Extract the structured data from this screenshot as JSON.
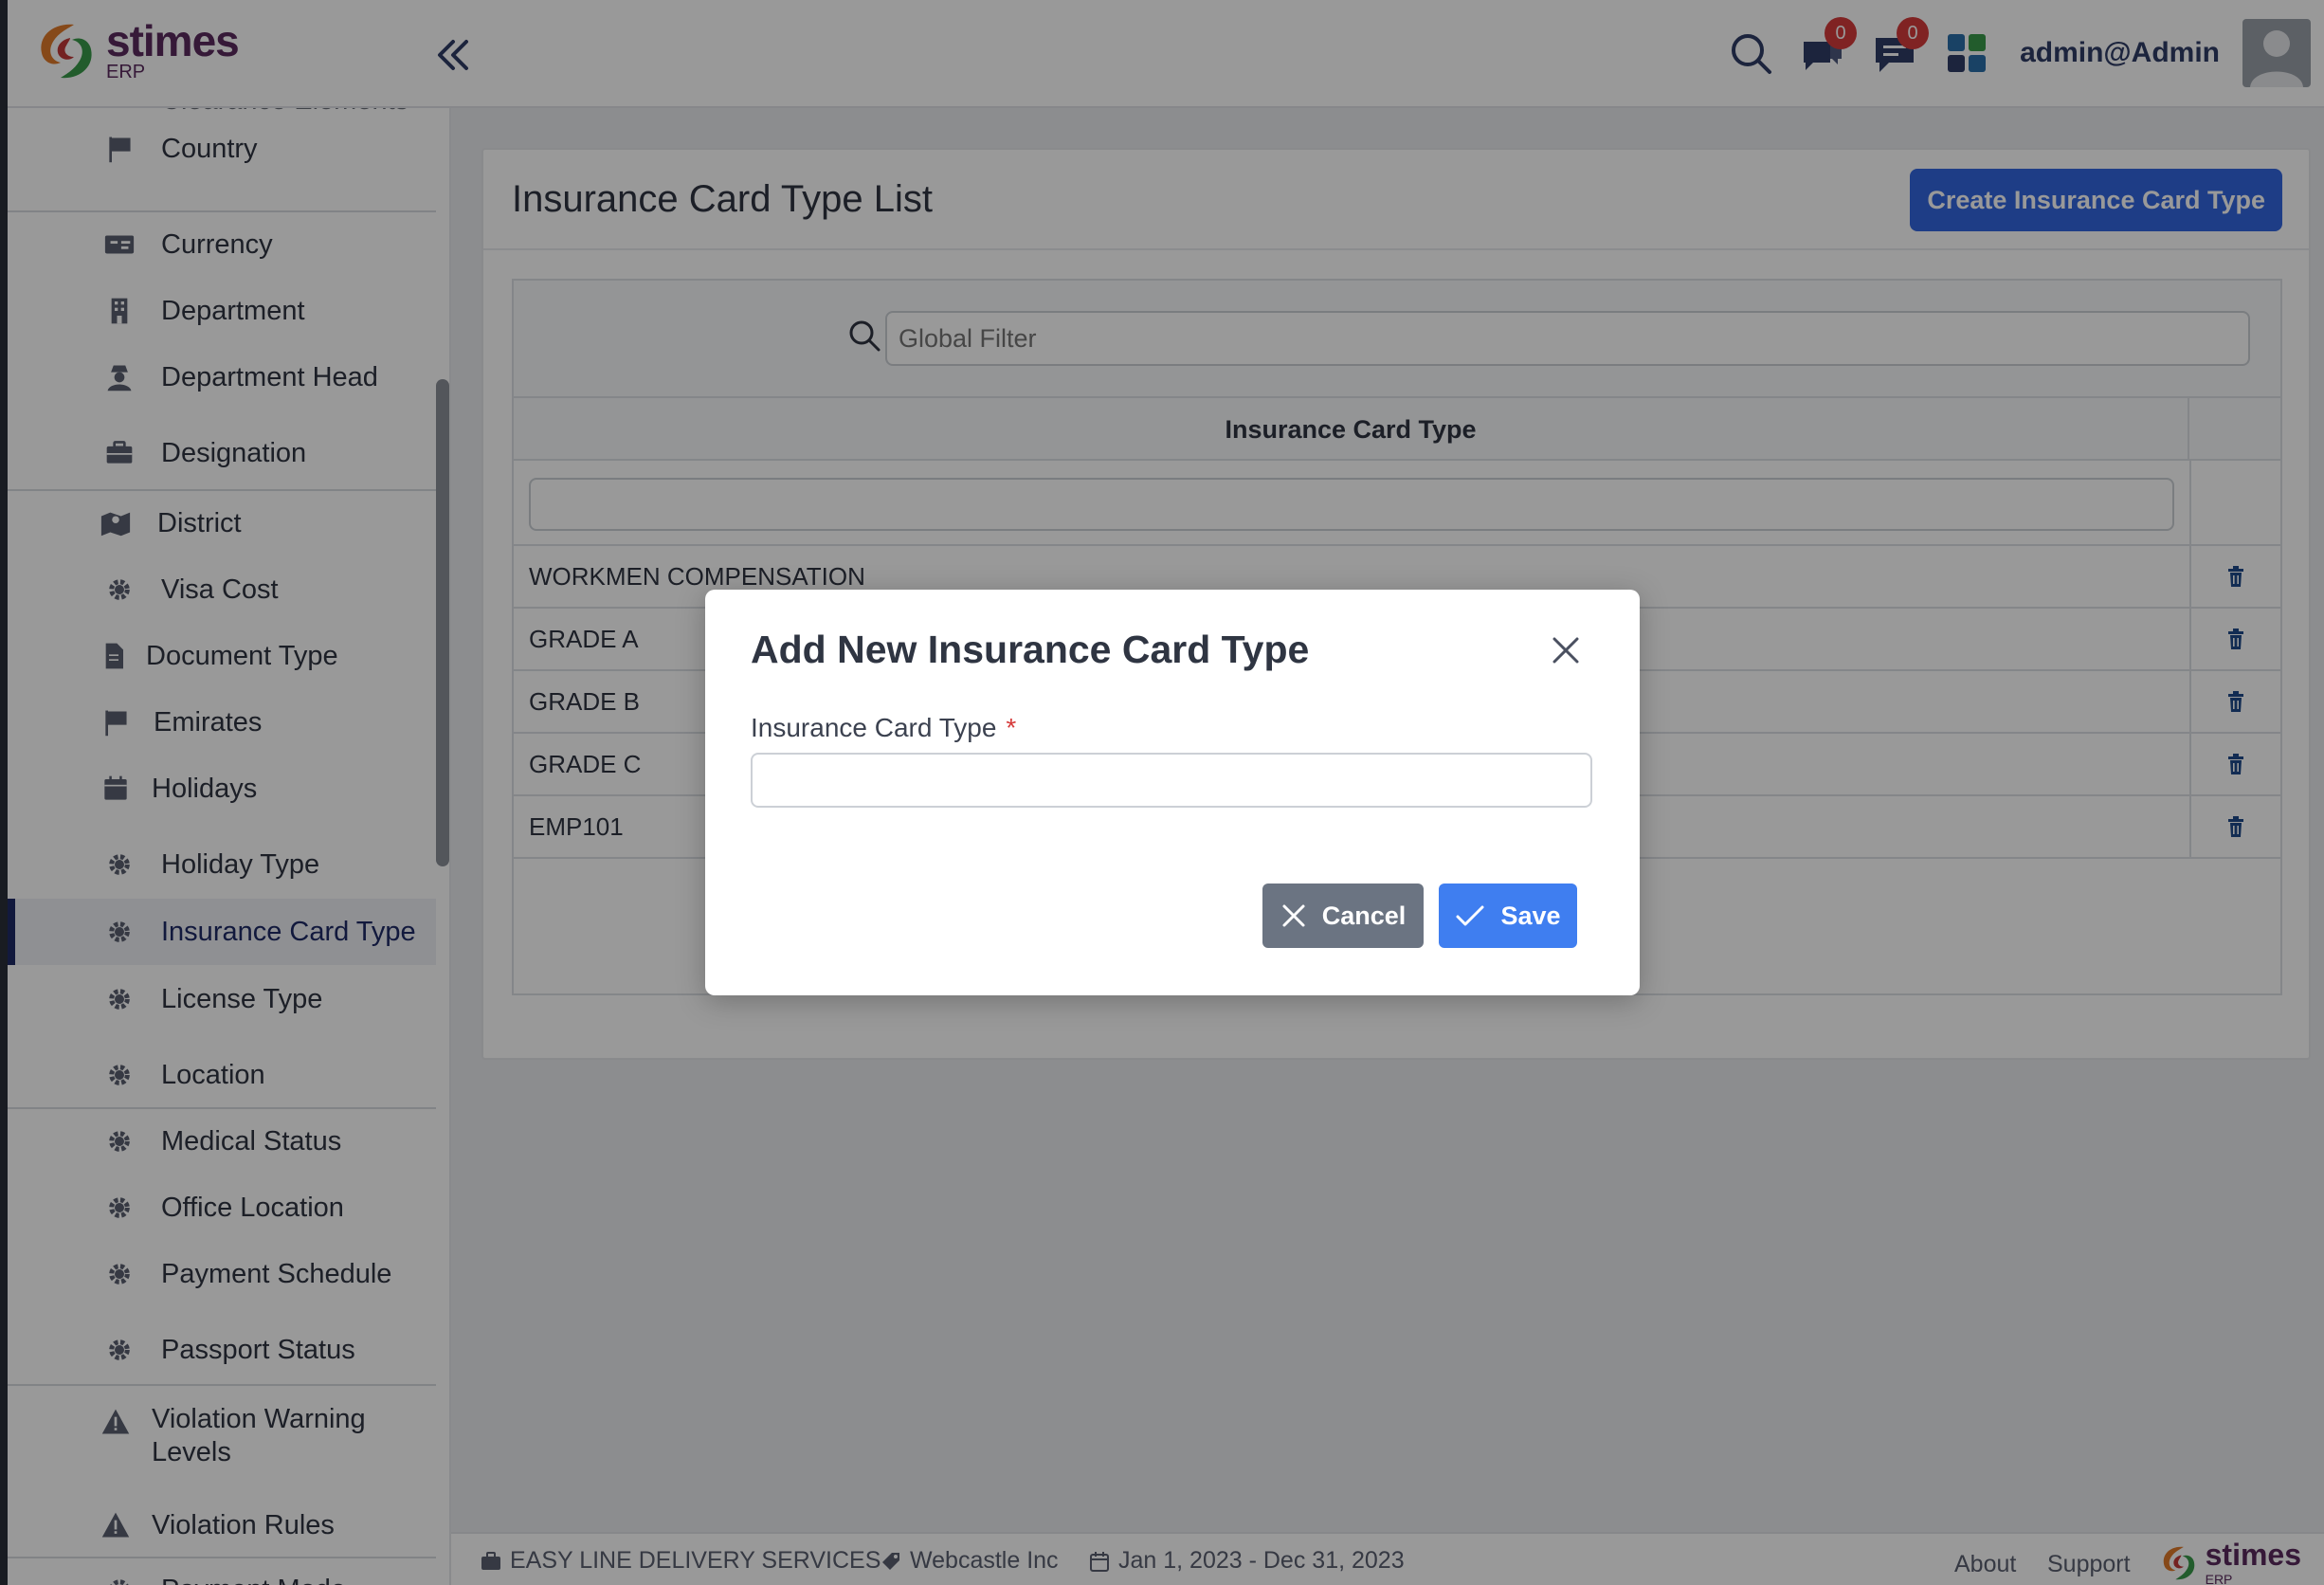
{
  "header": {
    "brand": "stimes",
    "brand_sub": "ERP",
    "notifications_count": "0",
    "messages_count": "0",
    "user_name": "admin@Admin"
  },
  "sidebar": {
    "cut_item": "Clearance Elements",
    "items": [
      {
        "label": "Country",
        "icon": "flag-icon"
      },
      {
        "label": "Currency",
        "icon": "money-icon"
      },
      {
        "label": "Department",
        "icon": "building-icon"
      },
      {
        "label": "Department Head",
        "icon": "user-secret-icon"
      },
      {
        "label": "Designation",
        "icon": "briefcase-icon"
      },
      {
        "label": "District",
        "icon": "map-icon"
      },
      {
        "label": "Visa Cost",
        "icon": "gear-icon"
      },
      {
        "label": "Document Type",
        "icon": "document-icon"
      },
      {
        "label": "Emirates",
        "icon": "flag-icon"
      },
      {
        "label": "Holidays",
        "icon": "calendar-icon"
      },
      {
        "label": "Holiday Type",
        "icon": "gear-icon"
      },
      {
        "label": "Insurance Card Type",
        "icon": "gear-icon",
        "active": true
      },
      {
        "label": "License Type",
        "icon": "gear-icon"
      },
      {
        "label": "Location",
        "icon": "gear-icon"
      },
      {
        "label": "Medical Status",
        "icon": "gear-icon"
      },
      {
        "label": "Office Location",
        "icon": "gear-icon"
      },
      {
        "label": "Payment Schedule",
        "icon": "gear-icon"
      },
      {
        "label": "Passport Status",
        "icon": "gear-icon"
      },
      {
        "label": "Violation Warning Levels",
        "icon": "warning-icon"
      },
      {
        "label": "Violation Rules",
        "icon": "warning-icon"
      },
      {
        "label": "Payment Mode",
        "icon": "gear-icon"
      }
    ]
  },
  "main": {
    "title": "Insurance Card Type List",
    "create_button": "Create Insurance Card Type",
    "global_filter_placeholder": "Global Filter",
    "column_header": "Insurance Card Type",
    "rows": [
      "WORKMEN COMPENSATION",
      "GRADE A",
      "GRADE B",
      "GRADE C",
      "EMP101"
    ]
  },
  "modal": {
    "title": "Add New Insurance Card Type",
    "field_label": "Insurance Card Type",
    "required_mark": "*",
    "field_value": "",
    "cancel_label": "Cancel",
    "save_label": "Save"
  },
  "footer": {
    "company": "EASY LINE DELIVERY SERVICES",
    "org": "Webcastle Inc",
    "period": "Jan 1, 2023 - Dec 31, 2023",
    "about": "About",
    "support": "Support",
    "brand": "stimes",
    "brand_sub": "ERP"
  }
}
